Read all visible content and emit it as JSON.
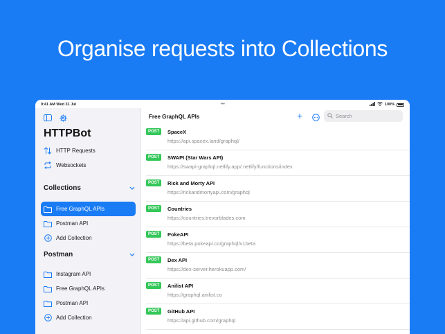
{
  "headline": "Organise requests into Collections",
  "status_bar": {
    "time": "9:41 AM   Wed 31 Jul",
    "battery_pct": "100%"
  },
  "sidebar": {
    "app_title": "HTTPBot",
    "nav": [
      {
        "label": "HTTP Requests",
        "icon": "arrows-up-down-icon"
      },
      {
        "label": "Websockets",
        "icon": "loop-arrows-icon"
      }
    ],
    "sections": [
      {
        "title": "Collections",
        "items": [
          {
            "label": "Free GraphQL APIs",
            "icon": "folder-icon",
            "selected": true
          },
          {
            "label": "Postman API",
            "icon": "folder-icon"
          },
          {
            "label": "Add Collection",
            "icon": "plus-circle-icon"
          }
        ]
      },
      {
        "title": "Postman",
        "items": [
          {
            "label": "Instagram API",
            "icon": "folder-icon"
          },
          {
            "label": "Free GraphQL APIs",
            "icon": "folder-icon"
          },
          {
            "label": "Postman API",
            "icon": "folder-icon"
          },
          {
            "label": "Add Collection",
            "icon": "plus-circle-icon"
          }
        ]
      }
    ]
  },
  "main": {
    "title": "Free GraphQL APIs",
    "search_placeholder": "Search",
    "requests": [
      {
        "method": "POST",
        "name": "SpaceX",
        "url": "https://api.spacex.land/graphql/"
      },
      {
        "method": "POST",
        "name": "SWAPI (Star Wars API)",
        "url": "https://swapi-graphql.netlify.app/.netlify/functions/index"
      },
      {
        "method": "POST",
        "name": "Rick and Morty API",
        "url": "https://rickandmortyapi.com/graphql"
      },
      {
        "method": "POST",
        "name": "Countries",
        "url": "https://countries.trevorblades.com"
      },
      {
        "method": "POST",
        "name": "PokeAPI",
        "url": "https://beta.pokeapi.co/graphql/v1beta"
      },
      {
        "method": "POST",
        "name": "Dex API",
        "url": "https://dex-server.herokuapp.com/"
      },
      {
        "method": "POST",
        "name": "Anilist API",
        "url": "https://graphql.anilist.co"
      },
      {
        "method": "POST",
        "name": "GitHub API",
        "url": "https://api.github.com/graphql"
      }
    ]
  },
  "colors": {
    "accent": "#1a7cf5",
    "post_badge": "#34c759"
  }
}
